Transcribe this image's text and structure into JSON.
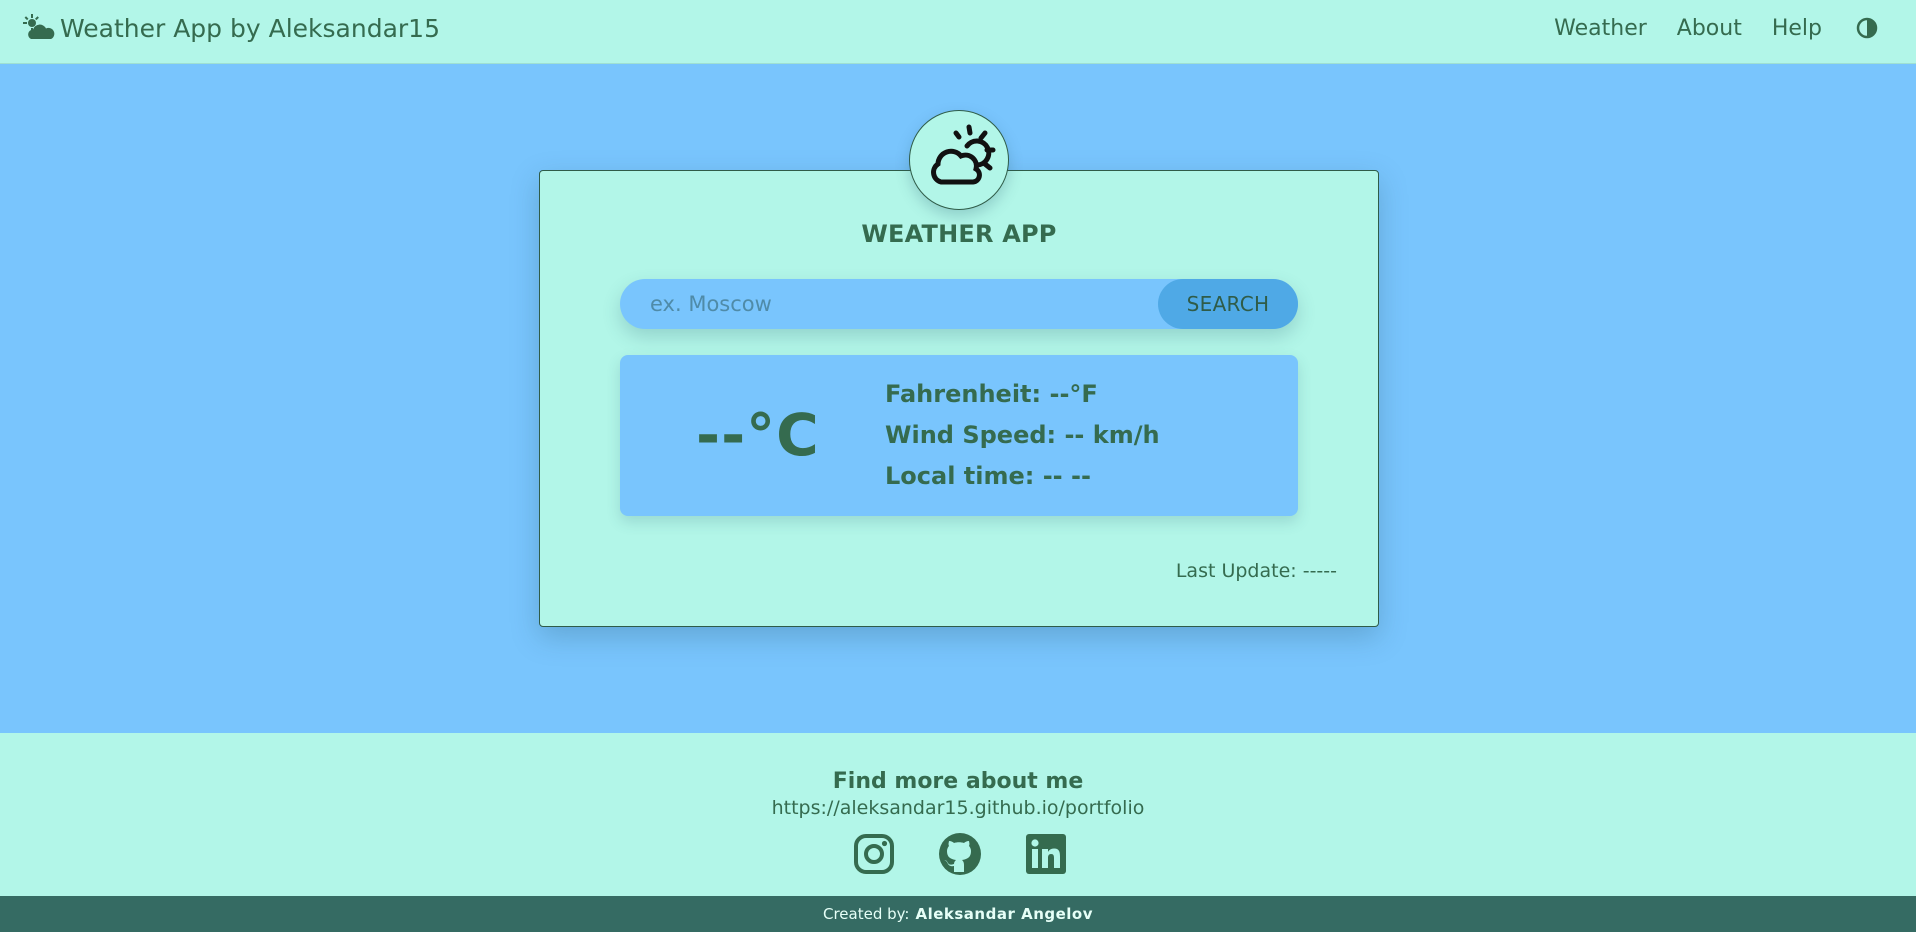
{
  "navbar": {
    "brand": "Weather App by Aleksandar15",
    "brand_icon": "sun-cloud-icon",
    "links": [
      "Weather",
      "About",
      "Help"
    ],
    "theme_toggle_icon": "half-circle-contrast-icon"
  },
  "card": {
    "logo_icon": "sun-behind-cloud-icon",
    "title": "WEATHER APP",
    "search": {
      "placeholder": "ex. Moscow",
      "value": "",
      "button": "SEARCH"
    },
    "temperature": "--°C",
    "details": {
      "fahrenheit": "Fahrenheit: --°F",
      "wind": "Wind Speed: -- km/h",
      "local_time": "Local time: -- --"
    },
    "last_update": "Last Update: -----"
  },
  "footer": {
    "title": "Find more about me",
    "link": "https://aleksandar15.github.io/portfolio",
    "social_icons": [
      "instagram-icon",
      "github-icon",
      "linkedin-icon"
    ],
    "credit_prefix": "Created by:",
    "credit_name": "Aleksandar Angelov"
  },
  "colors": {
    "page_bg": "#79c5fd",
    "panel_bg": "#b2f6e8",
    "text": "#356b4f",
    "button": "#4fa9e6",
    "credit_bar": "#356b63"
  }
}
